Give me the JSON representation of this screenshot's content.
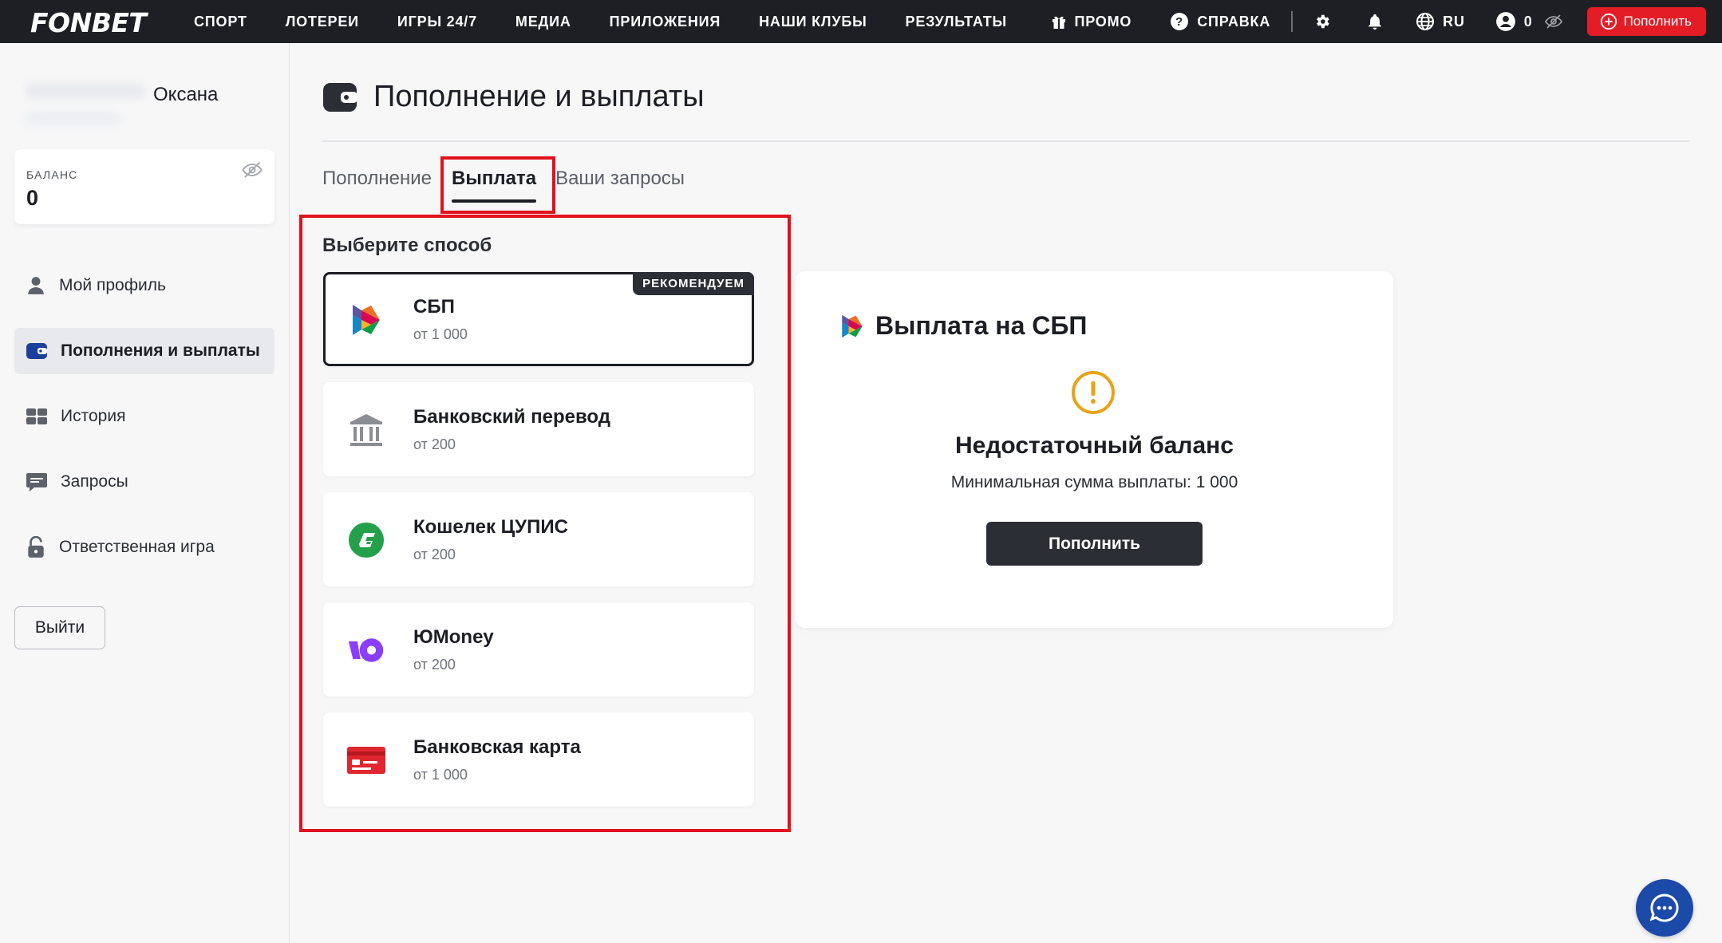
{
  "brand": {
    "logo": "FONBET"
  },
  "topnav": {
    "links": [
      "СПОРТ",
      "ЛОТЕРЕИ",
      "ИГРЫ 24/7",
      "МЕДИА",
      "ПРИЛОЖЕНИЯ",
      "НАШИ КЛУБЫ",
      "РЕЗУЛЬТАТЫ"
    ],
    "promo": "ПРОМО",
    "help": "СПРАВКА",
    "language": "RU",
    "account_balance": "0",
    "topup_label": "Пополнить"
  },
  "sidebar": {
    "user_name": "Оксана",
    "balance_label": "БАЛАНС",
    "balance_value": "0",
    "items": [
      {
        "label": "Мой профиль",
        "icon": "user-icon"
      },
      {
        "label": "Пополнения и выплаты",
        "icon": "wallet-icon",
        "active": true
      },
      {
        "label": "История",
        "icon": "history-icon"
      },
      {
        "label": "Запросы",
        "icon": "chat-bubble-icon"
      },
      {
        "label": "Ответственная игра",
        "icon": "lock-icon"
      }
    ],
    "logout_label": "Выйти"
  },
  "main": {
    "title": "Пополнение и выплаты",
    "tabs": [
      {
        "label": "Пополнение",
        "active": false
      },
      {
        "label": "Выплата",
        "active": true
      },
      {
        "label": "Ваши запросы",
        "active": false
      }
    ],
    "choose_label": "Выберите способ",
    "methods": [
      {
        "title": "СБП",
        "subtitle": "от 1 000",
        "badge": "РЕКОМЕНДУЕМ",
        "icon": "sbp-icon",
        "selected": true
      },
      {
        "title": "Банковский перевод",
        "subtitle": "от 200",
        "icon": "bank-icon"
      },
      {
        "title": "Кошелек ЦУПИС",
        "subtitle": "от 200",
        "icon": "cupis-icon"
      },
      {
        "title": "ЮMoney",
        "subtitle": "от 200",
        "icon": "yumoney-icon"
      },
      {
        "title": "Банковская карта",
        "subtitle": "от 1 000",
        "icon": "card-icon"
      }
    ]
  },
  "payout_card": {
    "title": "Выплата на СБП",
    "warning_title": "Недостаточный баланс",
    "warning_text": "Минимальная сумма выплаты: 1 000",
    "button_label": "Пополнить"
  },
  "colors": {
    "nav_bg": "#1d1f24",
    "accent_red": "#e31c25",
    "warning_orange": "#e8a317",
    "dark_button": "#2b2e35",
    "chat_blue": "#1b4aa8"
  }
}
